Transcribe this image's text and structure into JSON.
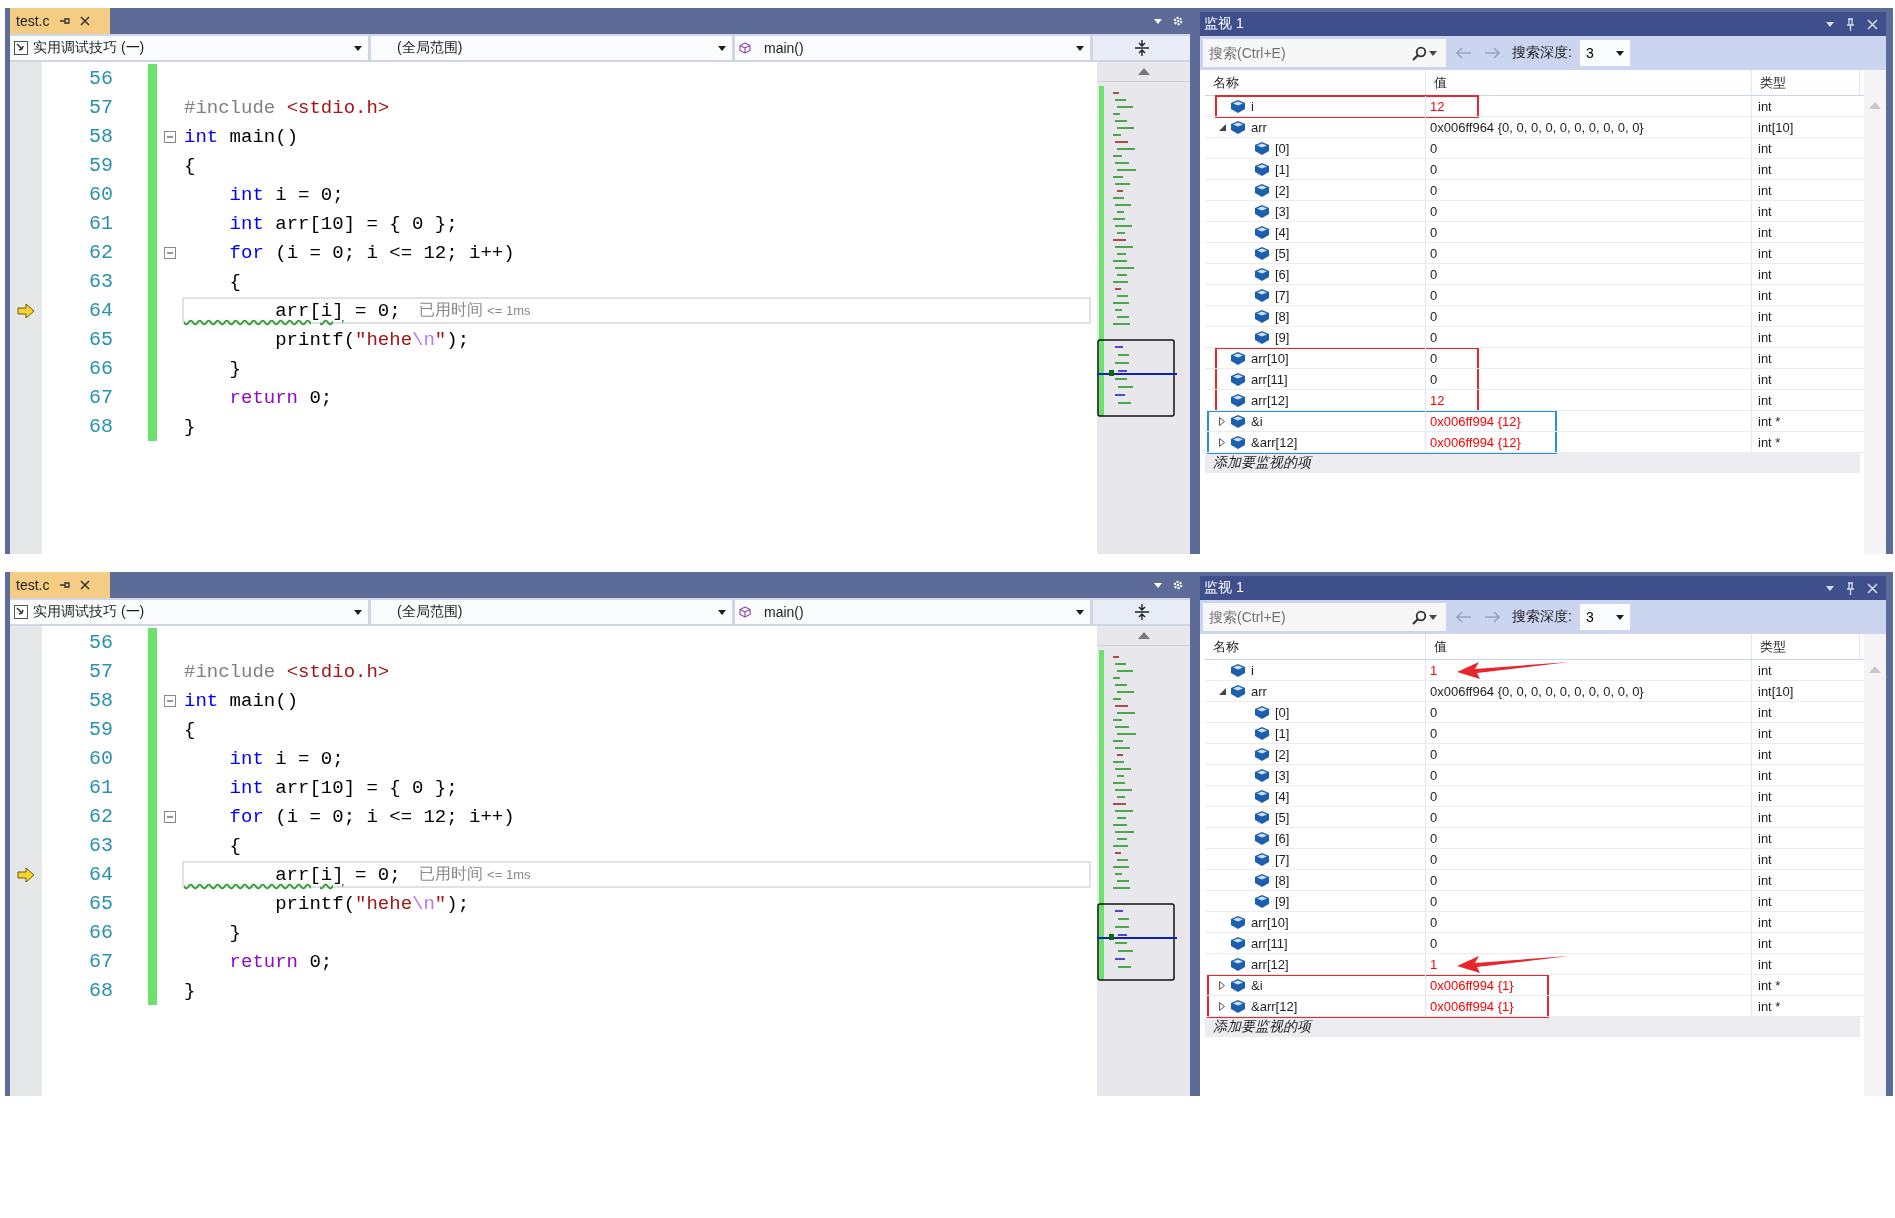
{
  "panels": [
    {
      "editor": {
        "tab": {
          "title": "test.c",
          "selected": true
        },
        "nav": {
          "project": "实用调试技巧 (一)",
          "scope": "(全局范围)",
          "member": "main()"
        },
        "lines": [
          {
            "number": "56",
            "fold": false,
            "current": false,
            "modified": true
          },
          {
            "number": "57",
            "tokens": [
              {
                "kind": "preproc",
                "text": "#include "
              },
              {
                "kind": "include",
                "text": "<stdio.h>"
              }
            ],
            "fold": false,
            "current": false,
            "modified": true
          },
          {
            "number": "58",
            "tokens": [
              {
                "kind": "keyword",
                "text": "int"
              },
              {
                "kind": "plain",
                "text": " main()"
              }
            ],
            "fold": true,
            "current": false,
            "modified": true
          },
          {
            "number": "59",
            "tokens": [
              {
                "kind": "plain",
                "text": "{"
              }
            ],
            "fold": false,
            "current": false,
            "modified": true
          },
          {
            "number": "60",
            "tokens": [
              {
                "kind": "keyword",
                "text": "    int"
              },
              {
                "kind": "plain",
                "text": " i = 0;"
              }
            ],
            "fold": false,
            "current": false,
            "modified": true
          },
          {
            "number": "61",
            "tokens": [
              {
                "kind": "keyword",
                "text": "    int"
              },
              {
                "kind": "plain",
                "text": " arr[10] = { 0 };"
              }
            ],
            "fold": false,
            "current": false,
            "modified": true
          },
          {
            "number": "62",
            "tokens": [
              {
                "kind": "keyword",
                "text": "    for"
              },
              {
                "kind": "plain",
                "text": " (i = 0; i <= 12; i++)"
              }
            ],
            "fold": true,
            "current": false,
            "modified": true
          },
          {
            "number": "63",
            "tokens": [
              {
                "kind": "plain",
                "text": "    {"
              }
            ],
            "fold": false,
            "current": false,
            "modified": true
          },
          {
            "number": "64",
            "tokens": [
              {
                "kind": "squiggle",
                "text": "        arr[i]"
              },
              {
                "kind": "plain",
                "text": " = 0;"
              }
            ],
            "tip": {
              "label": "已用时间",
              "detail": "<= 1ms"
            },
            "fold": false,
            "current": true,
            "modified": true
          },
          {
            "number": "65",
            "tokens": [
              {
                "kind": "plain",
                "text": "        printf("
              },
              {
                "kind": "string",
                "text": "\"hehe"
              },
              {
                "kind": "escape",
                "text": "\\n"
              },
              {
                "kind": "string",
                "text": "\""
              },
              {
                "kind": "plain",
                "text": ");"
              }
            ],
            "fold": false,
            "current": false,
            "modified": true
          },
          {
            "number": "66",
            "tokens": [
              {
                "kind": "plain",
                "text": "    }"
              }
            ],
            "fold": false,
            "current": false,
            "modified": true
          },
          {
            "number": "67",
            "tokens": [
              {
                "kind": "control",
                "text": "    return"
              },
              {
                "kind": "plain",
                "text": " 0;"
              }
            ],
            "fold": false,
            "current": false,
            "modified": true
          },
          {
            "number": "68",
            "tokens": [
              {
                "kind": "plain",
                "text": "}"
              }
            ],
            "fold": false,
            "current": false,
            "modified": true
          }
        ]
      },
      "watch": {
        "title": "监视 1",
        "search": {
          "placeholder": "搜索(Ctrl+E)"
        },
        "depth_label": "搜索深度:",
        "depth": "3",
        "columns": [
          "名称",
          "值",
          "类型"
        ],
        "rows": [
          {
            "name": "i",
            "value": "12",
            "type": "int",
            "changed": true,
            "box": {
              "color": "#e8262c"
            }
          },
          {
            "name": "arr",
            "value": "0x006ff964 {0, 0, 0, 0, 0, 0, 0, 0, 0, 0}",
            "type": "int[10]",
            "changed": false,
            "expanded": true,
            "children": [
              {
                "name": "[0]",
                "value": "0",
                "type": "int",
                "changed": false
              },
              {
                "name": "[1]",
                "value": "0",
                "type": "int",
                "changed": false
              },
              {
                "name": "[2]",
                "value": "0",
                "type": "int",
                "changed": false
              },
              {
                "name": "[3]",
                "value": "0",
                "type": "int",
                "changed": false
              },
              {
                "name": "[4]",
                "value": "0",
                "type": "int",
                "changed": false
              },
              {
                "name": "[5]",
                "value": "0",
                "type": "int",
                "changed": false
              },
              {
                "name": "[6]",
                "value": "0",
                "type": "int",
                "changed": false
              },
              {
                "name": "[7]",
                "value": "0",
                "type": "int",
                "changed": false
              },
              {
                "name": "[8]",
                "value": "0",
                "type": "int",
                "changed": false
              },
              {
                "name": "[9]",
                "value": "0",
                "type": "int",
                "changed": false
              }
            ]
          },
          {
            "name": "arr[10]",
            "value": "0",
            "type": "int",
            "changed": false,
            "box": {
              "color": "#e8262c"
            }
          },
          {
            "name": "arr[11]",
            "value": "0",
            "type": "int",
            "changed": false,
            "box": {
              "color": "#e8262c"
            }
          },
          {
            "name": "arr[12]",
            "value": "12",
            "type": "int",
            "changed": true,
            "box": {
              "color": "#e8262c"
            }
          },
          {
            "name": "&i",
            "value": "0x006ff994 {12}",
            "type": "int *",
            "changed": true,
            "expanded": false,
            "box": {
              "color": "#2b8fe0"
            }
          },
          {
            "name": "&arr[12]",
            "value": "0x006ff994 {12}",
            "type": "int *",
            "changed": true,
            "expanded": false,
            "box": {
              "color": "#2b8fe0"
            }
          }
        ],
        "add_hint": "添加要监视的项"
      }
    },
    {
      "editor": {
        "tab": {
          "title": "test.c",
          "selected": true
        },
        "nav": {
          "project": "实用调试技巧 (一)",
          "scope": "(全局范围)",
          "member": "main()"
        },
        "lines": [
          {
            "number": "56",
            "fold": false,
            "current": false,
            "modified": true
          },
          {
            "number": "57",
            "tokens": [
              {
                "kind": "preproc",
                "text": "#include "
              },
              {
                "kind": "include",
                "text": "<stdio.h>"
              }
            ],
            "fold": false,
            "current": false,
            "modified": true
          },
          {
            "number": "58",
            "tokens": [
              {
                "kind": "keyword",
                "text": "int"
              },
              {
                "kind": "plain",
                "text": " main()"
              }
            ],
            "fold": true,
            "current": false,
            "modified": true
          },
          {
            "number": "59",
            "tokens": [
              {
                "kind": "plain",
                "text": "{"
              }
            ],
            "fold": false,
            "current": false,
            "modified": true
          },
          {
            "number": "60",
            "tokens": [
              {
                "kind": "keyword",
                "text": "    int"
              },
              {
                "kind": "plain",
                "text": " i = 0;"
              }
            ],
            "fold": false,
            "current": false,
            "modified": true
          },
          {
            "number": "61",
            "tokens": [
              {
                "kind": "keyword",
                "text": "    int"
              },
              {
                "kind": "plain",
                "text": " arr[10] = { 0 };"
              }
            ],
            "fold": false,
            "current": false,
            "modified": true
          },
          {
            "number": "62",
            "tokens": [
              {
                "kind": "keyword",
                "text": "    for"
              },
              {
                "kind": "plain",
                "text": " (i = 0; i <= 12; i++)"
              }
            ],
            "fold": true,
            "current": false,
            "modified": true
          },
          {
            "number": "63",
            "tokens": [
              {
                "kind": "plain",
                "text": "    {"
              }
            ],
            "fold": false,
            "current": false,
            "modified": true
          },
          {
            "number": "64",
            "tokens": [
              {
                "kind": "squiggle",
                "text": "        arr[i]"
              },
              {
                "kind": "plain",
                "text": " = 0;"
              }
            ],
            "tip": {
              "label": "已用时间",
              "detail": "<= 1ms"
            },
            "fold": false,
            "current": true,
            "modified": true
          },
          {
            "number": "65",
            "tokens": [
              {
                "kind": "plain",
                "text": "        printf("
              },
              {
                "kind": "string",
                "text": "\"hehe"
              },
              {
                "kind": "escape",
                "text": "\\n"
              },
              {
                "kind": "string",
                "text": "\""
              },
              {
                "kind": "plain",
                "text": ");"
              }
            ],
            "fold": false,
            "current": false,
            "modified": true
          },
          {
            "number": "66",
            "tokens": [
              {
                "kind": "plain",
                "text": "    }"
              }
            ],
            "fold": false,
            "current": false,
            "modified": true
          },
          {
            "number": "67",
            "tokens": [
              {
                "kind": "control",
                "text": "    return"
              },
              {
                "kind": "plain",
                "text": " 0;"
              }
            ],
            "fold": false,
            "current": false,
            "modified": true
          },
          {
            "number": "68",
            "tokens": [
              {
                "kind": "plain",
                "text": "}"
              }
            ],
            "fold": false,
            "current": false,
            "modified": true
          }
        ]
      },
      "watch": {
        "title": "监视 1",
        "search": {
          "placeholder": "搜索(Ctrl+E)"
        },
        "depth_label": "搜索深度:",
        "depth": "3",
        "columns": [
          "名称",
          "值",
          "类型"
        ],
        "rows": [
          {
            "name": "i",
            "value": "1",
            "type": "int",
            "changed": true,
            "arrow": {
              "color": "#e8262c"
            }
          },
          {
            "name": "arr",
            "value": "0x006ff964 {0, 0, 0, 0, 0, 0, 0, 0, 0, 0}",
            "type": "int[10]",
            "changed": false,
            "expanded": true,
            "children": [
              {
                "name": "[0]",
                "value": "0",
                "type": "int",
                "changed": false
              },
              {
                "name": "[1]",
                "value": "0",
                "type": "int",
                "changed": false
              },
              {
                "name": "[2]",
                "value": "0",
                "type": "int",
                "changed": false
              },
              {
                "name": "[3]",
                "value": "0",
                "type": "int",
                "changed": false
              },
              {
                "name": "[4]",
                "value": "0",
                "type": "int",
                "changed": false
              },
              {
                "name": "[5]",
                "value": "0",
                "type": "int",
                "changed": false
              },
              {
                "name": "[6]",
                "value": "0",
                "type": "int",
                "changed": false
              },
              {
                "name": "[7]",
                "value": "0",
                "type": "int",
                "changed": false
              },
              {
                "name": "[8]",
                "value": "0",
                "type": "int",
                "changed": false
              },
              {
                "name": "[9]",
                "value": "0",
                "type": "int",
                "changed": false
              }
            ]
          },
          {
            "name": "arr[10]",
            "value": "0",
            "type": "int",
            "changed": false
          },
          {
            "name": "arr[11]",
            "value": "0",
            "type": "int",
            "changed": false
          },
          {
            "name": "arr[12]",
            "value": "1",
            "type": "int",
            "changed": true,
            "arrow": {
              "color": "#e8262c"
            }
          },
          {
            "name": "&i",
            "value": "0x006ff994 {1}",
            "type": "int *",
            "changed": true,
            "expanded": false,
            "box": {
              "color": "#e8262c"
            }
          },
          {
            "name": "&arr[12]",
            "value": "0x006ff994 {1}",
            "type": "int *",
            "changed": true,
            "expanded": false,
            "box": {
              "color": "#e8262c"
            }
          }
        ],
        "add_hint": "添加要监视的项"
      }
    }
  ]
}
